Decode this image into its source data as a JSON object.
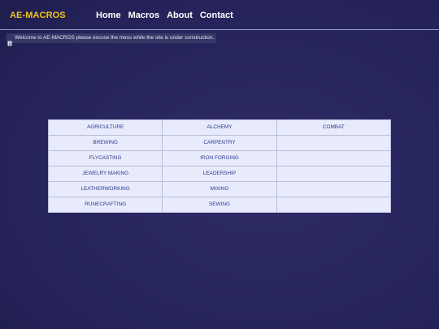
{
  "navbar": {
    "brand": "AE-MACROS",
    "links": [
      "Home",
      "Macros",
      "About",
      "Contact"
    ]
  },
  "notice": {
    "icon": "info-icon",
    "text": "Welcome to AE-MACROS please excuse the mess while the site is under construction."
  },
  "macros": {
    "rows": [
      [
        "AGRICULTURE",
        "ALCHEMY",
        "COMBAT"
      ],
      [
        "BREWING",
        "CARPENTRY",
        ""
      ],
      [
        "FLYCASTING",
        "IRON FORGING",
        ""
      ],
      [
        "JEWELRY MAKING",
        "LEADERSHIP",
        ""
      ],
      [
        "LEATHERWORKING",
        "MIXING",
        ""
      ],
      [
        "RUNECRAFTING",
        "SEWING",
        ""
      ]
    ]
  },
  "colors": {
    "brand": "#f0c419",
    "table_bg": "#e8ebfb",
    "table_text": "#2a3a8c"
  }
}
